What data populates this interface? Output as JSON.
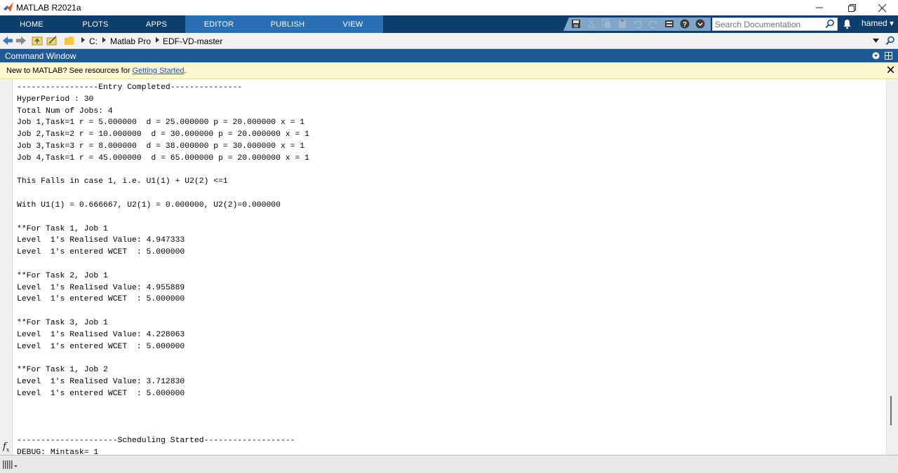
{
  "window": {
    "title": "MATLAB R2021a"
  },
  "toolstrip": {
    "tabs": [
      {
        "label": "HOME",
        "active": false
      },
      {
        "label": "PLOTS",
        "active": false
      },
      {
        "label": "APPS",
        "active": false
      },
      {
        "label": "EDITOR",
        "active": true
      },
      {
        "label": "PUBLISH",
        "active": false
      },
      {
        "label": "VIEW",
        "active": false
      }
    ],
    "search_placeholder": "Search Documentation",
    "user": "hamed ▾"
  },
  "address": {
    "crumbs": [
      "C:",
      "Matlab Pro",
      "EDF-VD-master"
    ]
  },
  "command_window": {
    "title": "Command Window",
    "info_text": "New to MATLAB? See resources for ",
    "info_link": "Getting Started",
    "info_suffix": ".",
    "lines": [
      "-----------------Entry Completed---------------",
      "HyperPeriod : 30",
      "Total Num of Jobs: 4",
      "Job 1,Task=1 r = 5.000000  d = 25.000000 p = 20.000000 x = 1",
      "Job 2,Task=2 r = 10.000000  d = 30.000000 p = 20.000000 x = 1",
      "Job 3,Task=3 r = 8.000000  d = 38.000000 p = 30.000000 x = 1",
      "Job 4,Task=1 r = 45.000000  d = 65.000000 p = 20.000000 x = 1",
      "",
      "This Falls in case 1, i.e. U1(1) + U2(2) <=1",
      "",
      "With U1(1) = 0.666667, U2(1) = 0.000000, U2(2)=0.000000",
      "",
      "**For Task 1, Job 1",
      "Level  1's Realised Value: 4.947333",
      "Level  1's entered WCET  : 5.000000",
      "",
      "**For Task 2, Job 1",
      "Level  1's Realised Value: 4.955889",
      "Level  1's entered WCET  : 5.000000",
      "",
      "**For Task 3, Job 1",
      "Level  1's Realised Value: 4.228063",
      "Level  1's entered WCET  : 5.000000",
      "",
      "**For Task 1, Job 2",
      "Level  1's Realised Value: 3.712830",
      "Level  1's entered WCET  : 5.000000",
      "",
      "",
      "",
      "---------------------Scheduling Started-------------------",
      "DEBUG: Mintask= 1"
    ]
  }
}
